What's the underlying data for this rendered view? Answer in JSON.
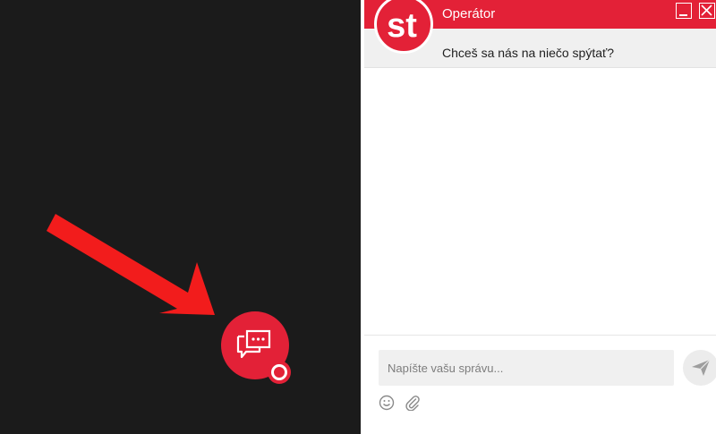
{
  "chat": {
    "operator_label": "Operátor",
    "greeting": "Chceš sa nás na niečo spýtať?",
    "avatar_text": "st",
    "input_placeholder": "Napíšte vašu správu..."
  },
  "icons": {
    "launcher": "chat-bubbles-icon",
    "status": "status-ring-icon",
    "minimize": "minimize-icon",
    "close": "close-icon",
    "send": "paper-plane-icon",
    "emoji": "smiley-icon",
    "attach": "paperclip-icon",
    "annotation": "red-arrow-icon"
  },
  "colors": {
    "brand_red": "#e32137",
    "dark_background": "#1b1b1b",
    "annotation_arrow": "#f21c1c"
  }
}
